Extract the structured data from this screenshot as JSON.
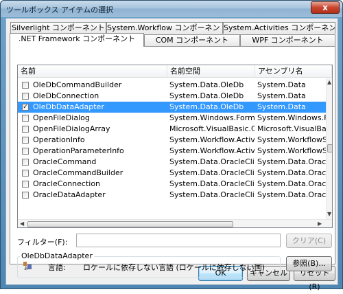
{
  "window": {
    "title": "ツールボックス アイテムの選択",
    "close": "x"
  },
  "tabs_back": [
    {
      "label": "Silverlight コンポーネント"
    },
    {
      "label": "System.Workflow コンポーネント"
    },
    {
      "label": "System.Activities コンポーネント"
    }
  ],
  "tabs_front": [
    {
      "label": ".NET Framework コンポーネント",
      "active": true
    },
    {
      "label": "COM コンポーネント"
    },
    {
      "label": "WPF コンポーネント"
    }
  ],
  "list": {
    "columns": [
      "名前",
      "名前空間",
      "アセンブリ名"
    ],
    "rows": [
      {
        "checked": false,
        "name": "OleDbCommandBuilder",
        "namespace": "System.Data.OleDb",
        "assembly": "System.Data"
      },
      {
        "checked": false,
        "name": "OleDbConnection",
        "namespace": "System.Data.OleDb",
        "assembly": "System.Data"
      },
      {
        "checked": true,
        "name": "OleDbDataAdapter",
        "namespace": "System.Data.OleDb",
        "assembly": "System.Data",
        "selected": true
      },
      {
        "checked": false,
        "name": "OpenFileDialog",
        "namespace": "System.Windows.Forms",
        "assembly": "System.Windows.For"
      },
      {
        "checked": false,
        "name": "OpenFileDialogArray",
        "namespace": "Microsoft.VisualBasic.Co...",
        "assembly": "Microsoft.VisualBasi"
      },
      {
        "checked": false,
        "name": "OperationInfo",
        "namespace": "System.Workflow.Activities",
        "assembly": "System.WorkflowSer"
      },
      {
        "checked": false,
        "name": "OperationParameterInfo",
        "namespace": "System.Workflow.Activities",
        "assembly": "System.WorkflowSer"
      },
      {
        "checked": false,
        "name": "OracleCommand",
        "namespace": "System.Data.OracleClient",
        "assembly": "System.Data.Oracle"
      },
      {
        "checked": false,
        "name": "OracleCommandBuilder",
        "namespace": "System.Data.OracleClient",
        "assembly": "System.Data.Oracle"
      },
      {
        "checked": false,
        "name": "OracleConnection",
        "namespace": "System.Data.OracleClient",
        "assembly": "System.Data.Oracle"
      },
      {
        "checked": false,
        "name": "OracleDataAdapter",
        "namespace": "System.Data.OracleClient",
        "assembly": "System.Data.Oracle"
      }
    ]
  },
  "filter": {
    "label": "フィルター(F):",
    "value": "",
    "clear_label": "クリア(C)"
  },
  "info": {
    "title": "OleDbDataAdapter",
    "language_key": "言語:",
    "language_value": "ロケールに依存しない言語 (ロケールに依存しない国)",
    "browse_label": "参照(B)..."
  },
  "buttons": {
    "ok": "OK",
    "cancel": "キャンセル",
    "reset": "リセット(R)"
  },
  "colors": {
    "selection": "#3399ff",
    "title_bar": "#8fb3d3"
  }
}
